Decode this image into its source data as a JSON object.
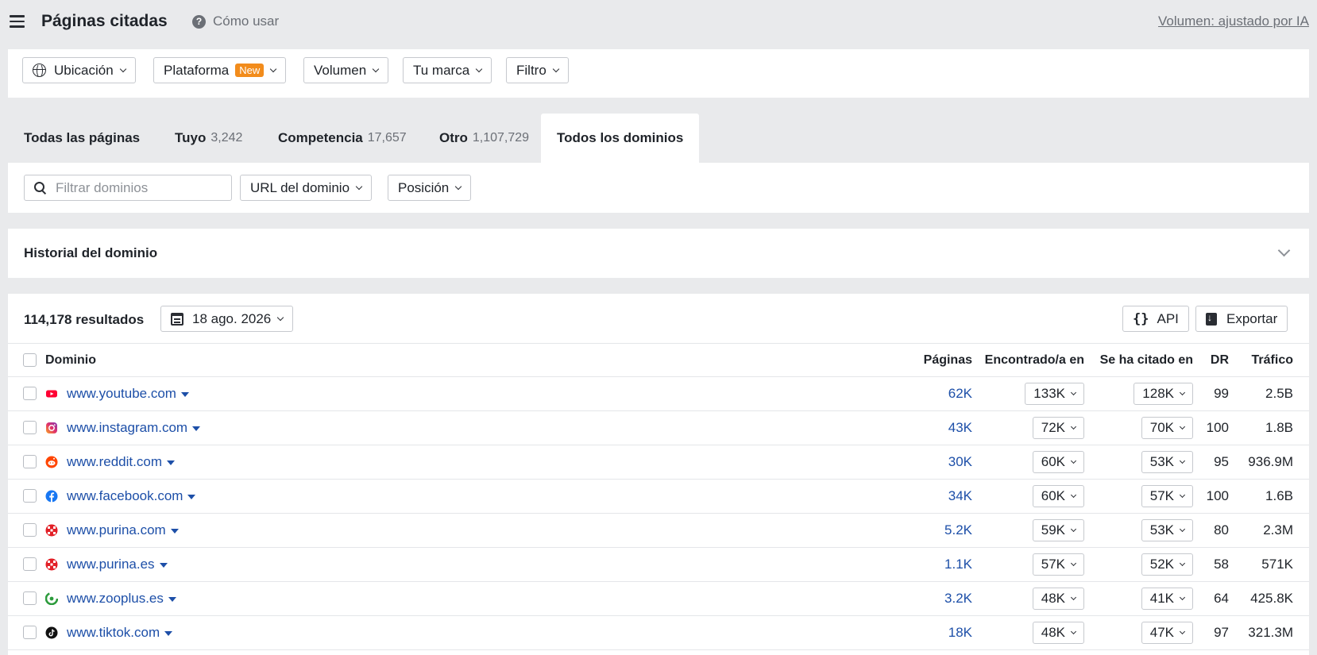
{
  "header": {
    "title": "Páginas citadas",
    "help_label": "Cómo usar",
    "volume_link": "Volumen: ajustado por IA"
  },
  "filters": {
    "location": "Ubicación",
    "platform": "Plataforma",
    "platform_badge": "New",
    "volume": "Volumen",
    "brand": "Tu marca",
    "filter": "Filtro"
  },
  "tabs": [
    {
      "label": "Todas las páginas",
      "count": ""
    },
    {
      "label": "Tuyo",
      "count": "3,242"
    },
    {
      "label": "Competencia",
      "count": "17,657"
    },
    {
      "label": "Otro",
      "count": "1,107,729"
    },
    {
      "label": "Todos los dominios",
      "count": ""
    }
  ],
  "domain_filters": {
    "search_placeholder": "Filtrar dominios",
    "url_filter": "URL del dominio",
    "position_filter": "Posición"
  },
  "history": {
    "title": "Historial del dominio"
  },
  "results": {
    "count": "114,178 resultados",
    "date": "18 ago. 2026",
    "api_label": "API",
    "export_label": "Exportar"
  },
  "columns": {
    "domain": "Dominio",
    "pages": "Páginas",
    "found_in": "Encontrado/a en",
    "cited_in": "Se ha citado en",
    "dr": "DR",
    "traffic": "Tráfico"
  },
  "rows": [
    {
      "domain": "www.youtube.com",
      "icon": "youtube-icon",
      "pages": "62K",
      "found": "133K",
      "cited": "128K",
      "dr": "99",
      "traffic": "2.5B"
    },
    {
      "domain": "www.instagram.com",
      "icon": "instagram-icon",
      "pages": "43K",
      "found": "72K",
      "cited": "70K",
      "dr": "100",
      "traffic": "1.8B"
    },
    {
      "domain": "www.reddit.com",
      "icon": "reddit-icon",
      "pages": "30K",
      "found": "60K",
      "cited": "53K",
      "dr": "95",
      "traffic": "936.9M"
    },
    {
      "domain": "www.facebook.com",
      "icon": "facebook-icon",
      "pages": "34K",
      "found": "60K",
      "cited": "57K",
      "dr": "100",
      "traffic": "1.6B"
    },
    {
      "domain": "www.purina.com",
      "icon": "purina-icon",
      "pages": "5.2K",
      "found": "59K",
      "cited": "53K",
      "dr": "80",
      "traffic": "2.3M"
    },
    {
      "domain": "www.purina.es",
      "icon": "purina-icon",
      "pages": "1.1K",
      "found": "57K",
      "cited": "52K",
      "dr": "58",
      "traffic": "571K"
    },
    {
      "domain": "www.zooplus.es",
      "icon": "zooplus-icon",
      "pages": "3.2K",
      "found": "48K",
      "cited": "41K",
      "dr": "64",
      "traffic": "425.8K"
    },
    {
      "domain": "www.tiktok.com",
      "icon": "tiktok-icon",
      "pages": "18K",
      "found": "48K",
      "cited": "47K",
      "dr": "97",
      "traffic": "321.3M"
    }
  ],
  "colors": {
    "link": "#1d4fa8",
    "badge_new": "#f28c1c",
    "background": "#e9eaec"
  }
}
